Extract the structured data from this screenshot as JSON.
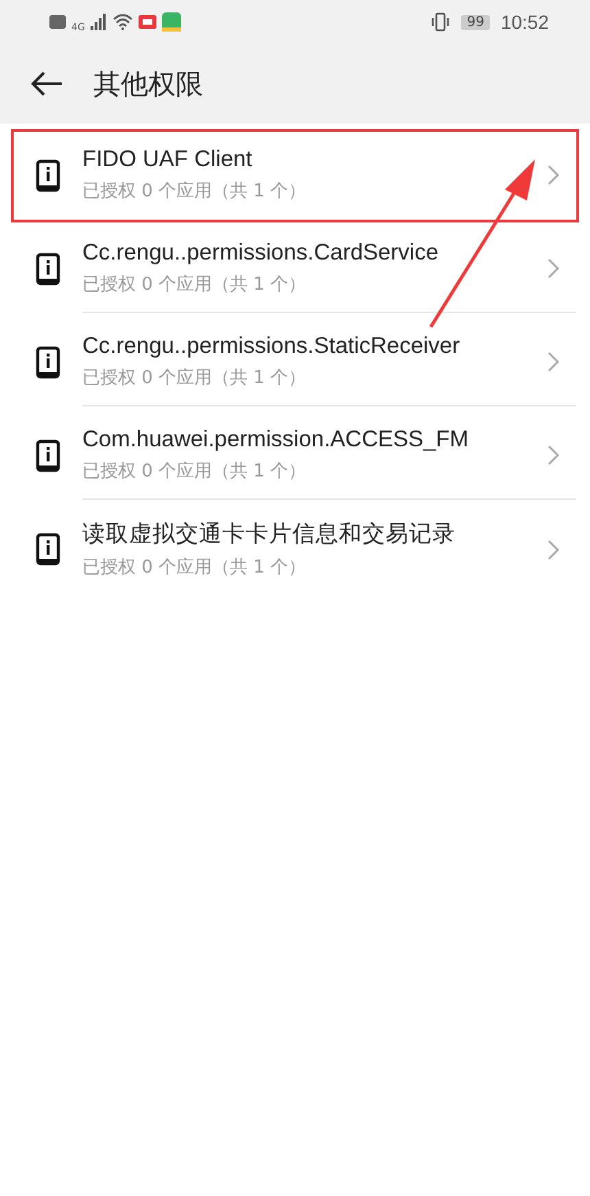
{
  "status_bar": {
    "battery": "99",
    "time": "10:52",
    "network": "4G"
  },
  "header": {
    "title": "其他权限"
  },
  "permissions": [
    {
      "name": "FIDO UAF Client",
      "summary": "已授权 0 个应用（共 1 个）",
      "highlighted": true
    },
    {
      "name": "Cc.rengu..permissions.CardService",
      "summary": "已授权 0 个应用（共 1 个）",
      "highlighted": false
    },
    {
      "name": "Cc.rengu..permissions.StaticReceiver",
      "summary": "已授权 0 个应用（共 1 个）",
      "highlighted": false
    },
    {
      "name": "Com.huawei.permission.ACCESS_FM",
      "summary": "已授权 0 个应用（共 1 个）",
      "highlighted": false
    },
    {
      "name": "读取虚拟交通卡卡片信息和交易记录",
      "summary": "已授权 0 个应用（共 1 个）",
      "highlighted": false
    }
  ]
}
